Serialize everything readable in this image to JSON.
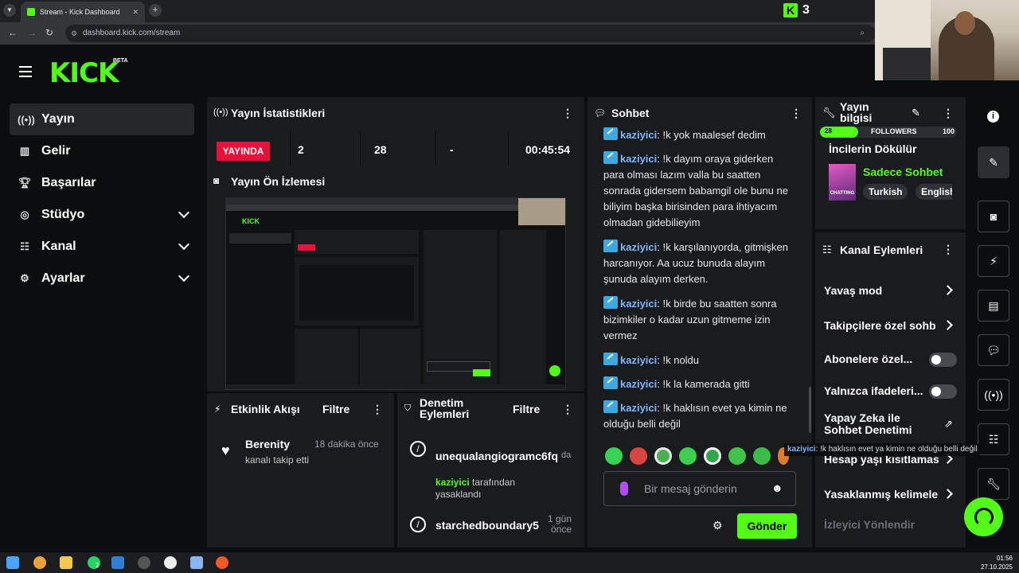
{
  "browser": {
    "tab_title": "Stream - Kick Dashboard",
    "url": "dashboard.kick.com/stream",
    "kick_count": "3"
  },
  "logo": {
    "text": "KICK",
    "badge": "BETA"
  },
  "sidebar": {
    "items": [
      {
        "label": "Yayın",
        "icon": "live-icon"
      },
      {
        "label": "Gelir",
        "icon": "chart-icon"
      },
      {
        "label": "Başarılar",
        "icon": "trophy-icon"
      },
      {
        "label": "Stüdyo",
        "icon": "studio-icon"
      },
      {
        "label": "Kanal",
        "icon": "channel-icon"
      },
      {
        "label": "Ayarlar",
        "icon": "gear-icon"
      }
    ]
  },
  "stats": {
    "title": "Yayın İstatistikleri",
    "live_label": "YAYINDA",
    "viewers": "2",
    "followers": "28",
    "subs": "-",
    "duration": "00:45:54"
  },
  "preview": {
    "title": "Yayın Ön İzlemesi"
  },
  "activity": {
    "title": "Etkinlik Akışı",
    "filter": "Filtre",
    "items": [
      {
        "user": "Berenity",
        "time": "18 dakika önce",
        "desc": "kanalı takip etti"
      }
    ]
  },
  "moderation": {
    "title_line1": "Denetim",
    "title_line2": "Eylemleri",
    "filter": "Filtre",
    "items": [
      {
        "user": "unequalangiogramc6fq",
        "time": "da",
        "by": "kaziyici",
        "by_suffix": "tarafından",
        "action": "yasaklandı"
      },
      {
        "user": "starchedboundary5",
        "time_line1": "1 gün",
        "time_line2": "önce"
      }
    ]
  },
  "chat": {
    "title": "Sohbet",
    "messages": [
      {
        "user": "kaziyici",
        "text": ": !k yok maalesef dedim"
      },
      {
        "user": "kaziyici",
        "text": ": !k dayım oraya giderken para olması lazım valla bu saatten sonrada gidersem babamgil ole bunu ne biliyim başka birisinden para ihtiyacım olmadan gidebilieyim"
      },
      {
        "user": "kaziyici",
        "text": ": !k karşılanıyorda, gitmişken harcanıyor. Aa ucuz bunuda alayım şunuda alayım derken."
      },
      {
        "user": "kaziyici",
        "text": ": !k birde bu saatten sonra bizimkiler o kadar uzun gitmeme izin vermez"
      },
      {
        "user": "kaziyici",
        "text": ": !k noldu"
      },
      {
        "user": "kaziyici",
        "text": ": !k la kamerada gitti"
      },
      {
        "user": "kaziyici",
        "text": ": !k haklısın evet ya kimin ne olduğu belli değil"
      }
    ],
    "input_placeholder": "Bir mesaj gönderin",
    "send_label": "Gönder"
  },
  "stream_info": {
    "title_line1": "Yayın",
    "title_line2": "bilgisi",
    "followers_current": "28",
    "followers_label": "FOLLOWERS",
    "followers_goal": "100",
    "followers_progress": 0.28,
    "stream_title": "İncilerin Dökülür",
    "category": "Sadece Sohbet",
    "category_thumb": "CHATTING",
    "tags": [
      "Turkish",
      "English"
    ]
  },
  "channel_actions": {
    "title": "Kanal Eylemleri",
    "items": [
      {
        "label": "Yavaş mod",
        "control": "arrow"
      },
      {
        "label": "Takipçilere özel sohb",
        "control": "arrow"
      },
      {
        "label": "Abonelere özel...",
        "control": "toggle"
      },
      {
        "label": "Yalnızca ifadeleri...",
        "control": "toggle"
      },
      {
        "label": "Yapay Zeka ile Sohbet Denetimi",
        "control": "external"
      },
      {
        "label": "Hesap yaşı kısıtlamas",
        "control": "arrow"
      },
      {
        "label": "Yasaklanmış kelimele",
        "control": "arrow"
      },
      {
        "label": "İzleyici Yönlendir",
        "control": "none"
      }
    ]
  },
  "toast": {
    "user": "kaziyici",
    "text": ": !k haklısın evet ya kimin ne olduğu belli değil"
  },
  "clock": {
    "time": "01:56",
    "date": "27.10.2025"
  },
  "taskbar": {
    "whatsapp_badge": "2"
  },
  "colors": {
    "accent": "#53fc18",
    "live": "#e9113c",
    "panel": "#191b1f",
    "bg": "#0b0e0f",
    "username": "#7fb7ff"
  }
}
